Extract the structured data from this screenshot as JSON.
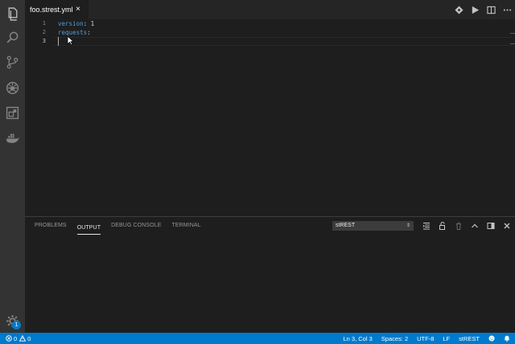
{
  "activity_bar": {
    "items": [
      "explorer-icon",
      "search-icon",
      "source-control-icon",
      "debug-icon",
      "extensions-icon",
      "docker-icon"
    ],
    "settings_badge": "1"
  },
  "tab": {
    "label": "foo.strest.yml",
    "close": "×"
  },
  "editor": {
    "line_numbers": [
      "1",
      "2",
      "3"
    ],
    "lines": [
      {
        "key": "version",
        "sep": ": ",
        "value": "1"
      },
      {
        "key": "requests",
        "sep": ":",
        "value": ""
      },
      {
        "key": "",
        "sep": "",
        "value": ""
      }
    ]
  },
  "panel": {
    "tabs": [
      "PROBLEMS",
      "OUTPUT",
      "DEBUG CONSOLE",
      "TERMINAL"
    ],
    "active_tab": "OUTPUT",
    "output_channel": "stREST"
  },
  "status_bar": {
    "errors": "0",
    "warnings": "0",
    "cursor": "Ln 3, Col 3",
    "indent": "Spaces: 2",
    "encoding": "UTF-8",
    "eol": "LF",
    "language": "stREST"
  },
  "colors": {
    "status_bar": "#007acc",
    "activity_bar": "#333333",
    "editor_bg": "#1e1e1e",
    "yaml_key": "#569cd6"
  }
}
